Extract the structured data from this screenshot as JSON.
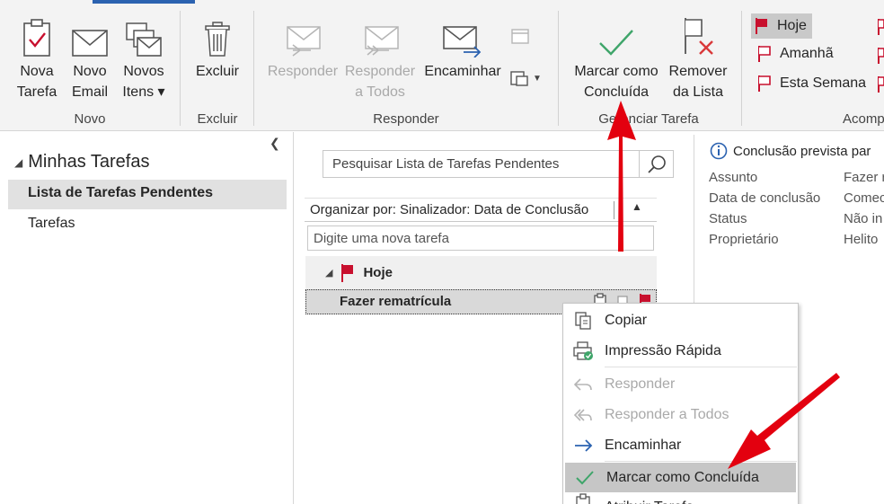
{
  "ribbon": {
    "groups": {
      "novo": "Novo",
      "excluir": "Excluir",
      "responder": "Responder",
      "gerenciar": "Gerenciar Tarefa",
      "acompanhamento": "Acomp"
    },
    "buttons": {
      "nova_tarefa": [
        "Nova",
        "Tarefa"
      ],
      "novo_email": [
        "Novo",
        "Email"
      ],
      "novos_itens": [
        "Novos",
        "Itens ▾"
      ],
      "excluir": "Excluir",
      "responder": "Responder",
      "responder_todos": [
        "Responder",
        "a Todos"
      ],
      "encaminhar": "Encaminhar",
      "marcar": [
        "Marcar como",
        "Concluída"
      ],
      "remover": [
        "Remover",
        "da Lista"
      ]
    },
    "followup": [
      "Hoje",
      "Amanhã",
      "Esta Semana"
    ]
  },
  "folders": {
    "header": "Minhas Tarefas",
    "items": [
      "Lista de Tarefas Pendentes",
      "Tarefas"
    ]
  },
  "tasklist": {
    "search_placeholder": "Pesquisar Lista de Tarefas Pendentes",
    "arrange_by": "Organizar por: Sinalizador: Data de Conclusão",
    "new_task_placeholder": "Digite uma nova tarefa",
    "group_label": "Hoje",
    "task": "Fazer rematrícula"
  },
  "reading": {
    "info": "Conclusão prevista par",
    "props": [
      {
        "key": "Assunto",
        "value": "Fazer r"
      },
      {
        "key": "Data de conclusão",
        "value": "Comec"
      },
      {
        "key": "Status",
        "value": "Não in"
      },
      {
        "key": "Proprietário",
        "value": "Helito"
      }
    ]
  },
  "context_menu": {
    "items": [
      "Copiar",
      "Impressão Rápida",
      "Responder",
      "Responder a Todos",
      "Encaminhar",
      "Marcar como Concluída",
      "Atribuir Tarefa"
    ]
  },
  "colors": {
    "accent": "#2b62b0",
    "flag_red": "#c8102e",
    "check_green": "#3fa56a",
    "arrow_red": "#e3000f"
  }
}
